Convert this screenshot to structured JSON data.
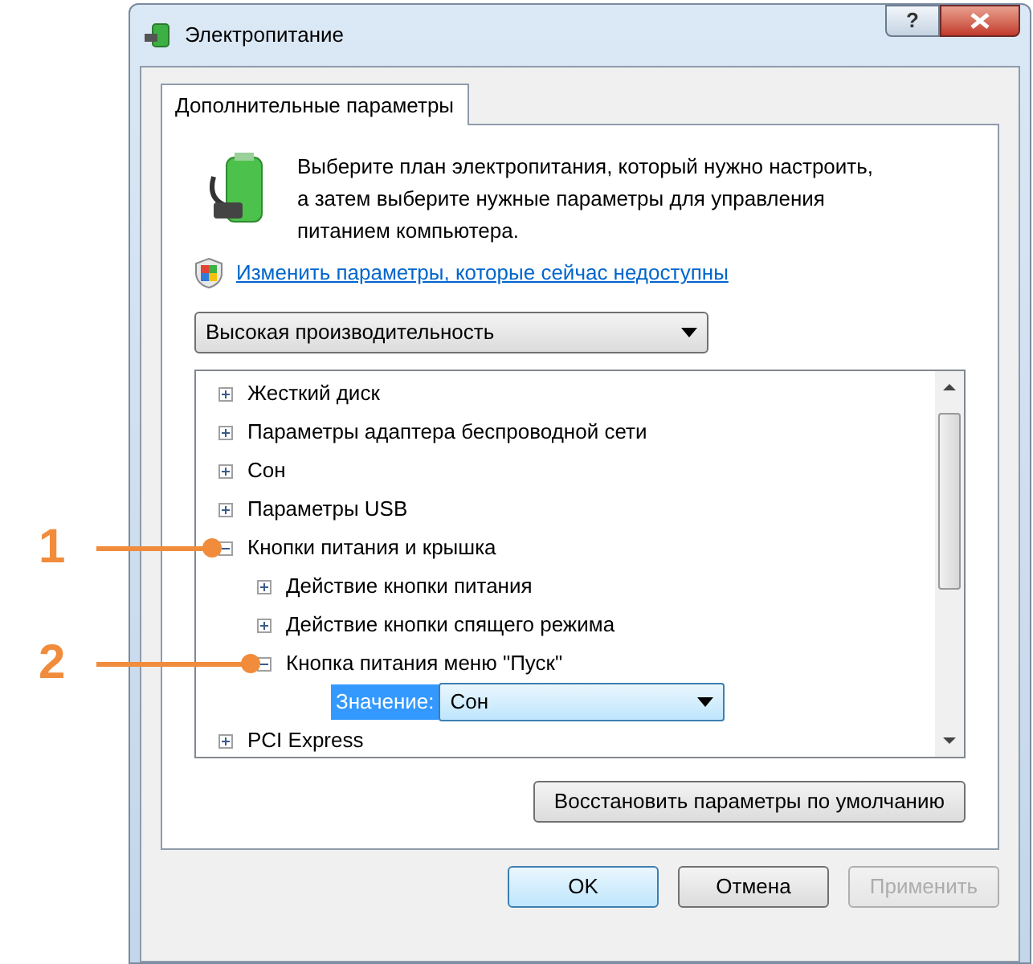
{
  "window": {
    "title": "Электропитание",
    "help_button": "?"
  },
  "tabs": [
    {
      "label": "Дополнительные параметры",
      "selected": true
    }
  ],
  "intro": "Выберите план электропитания, который нужно настроить, а затем выберите нужные параметры для управления питанием компьютера.",
  "link": "Изменить параметры, которые сейчас недоступны",
  "plan_select": {
    "value": "Высокая производительность"
  },
  "tree": [
    {
      "label": "Жесткий диск",
      "expanded": false
    },
    {
      "label": "Параметры адаптера беспроводной сети",
      "expanded": false
    },
    {
      "label": "Сон",
      "expanded": false
    },
    {
      "label": "Параметры USB",
      "expanded": false
    },
    {
      "label": "Кнопки питания и крышка",
      "expanded": true,
      "callout": "1",
      "children": [
        {
          "label": "Действие кнопки питания",
          "expanded": false
        },
        {
          "label": "Действие кнопки спящего режима",
          "expanded": false
        },
        {
          "label": "Кнопка питания меню \"Пуск\"",
          "expanded": true,
          "callout": "2",
          "setting": {
            "label": "Значение:",
            "value": "Сон"
          }
        }
      ]
    },
    {
      "label": "PCI Express",
      "expanded": false
    }
  ],
  "restore_button": "Восстановить параметры по умолчанию",
  "buttons": [
    {
      "label": "OK",
      "kind": "default",
      "disabled": false
    },
    {
      "label": "Отмена",
      "kind": "normal",
      "disabled": false
    },
    {
      "label": "Применить",
      "kind": "normal",
      "disabled": true
    }
  ]
}
